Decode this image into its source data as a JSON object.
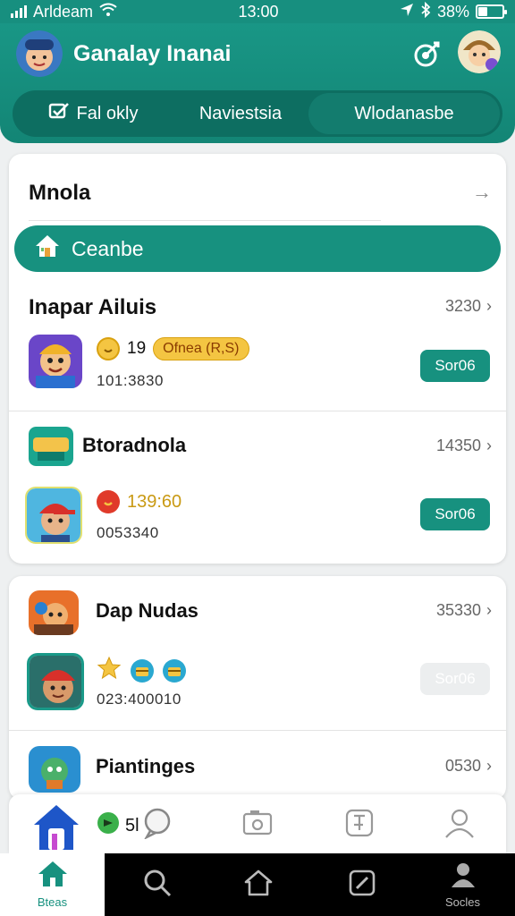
{
  "status_bar": {
    "carrier": "Arldeam",
    "time": "13:00",
    "battery": "38%",
    "battery_level": 0.38
  },
  "header": {
    "title": "Ganalay Inanai"
  },
  "tabs": [
    {
      "label": "Fal okly",
      "icon": "checkbox-icon"
    },
    {
      "label": "Naviestsia"
    },
    {
      "label": "Wlodanasbe",
      "active": true
    }
  ],
  "section_main": {
    "title": "Mnola"
  },
  "create_button": {
    "label": "Ceanbe"
  },
  "lists": [
    {
      "title": "Inapar Ailuis",
      "count": "3230",
      "item": {
        "level": "19",
        "badge": "Ofnea (R,S)",
        "value": "101:3830",
        "action": "Sor06"
      }
    },
    {
      "title": "Btoradnola",
      "count": "14350",
      "item": {
        "score": "139:60",
        "value": "0053340",
        "action": "Sor06"
      }
    },
    {
      "title": "Dap Nudas",
      "count": "35330",
      "item": {
        "value": "023:400010",
        "action": "Sor06",
        "disabled": true
      }
    },
    {
      "title": "Piantinges",
      "count": "0530"
    }
  ],
  "float_bar": {
    "text": "5l"
  },
  "bottom_nav": [
    {
      "label": "Bteas",
      "icon": "home-icon",
      "active": true
    },
    {
      "label": "",
      "icon": "search-icon"
    },
    {
      "label": "",
      "icon": "house-outline-icon"
    },
    {
      "label": "",
      "icon": "edit-icon"
    },
    {
      "label": "Socles",
      "icon": "profile-icon"
    }
  ],
  "colors": {
    "primary": "#17917f",
    "header": "#1a9a89",
    "accent": "#f4c542"
  }
}
